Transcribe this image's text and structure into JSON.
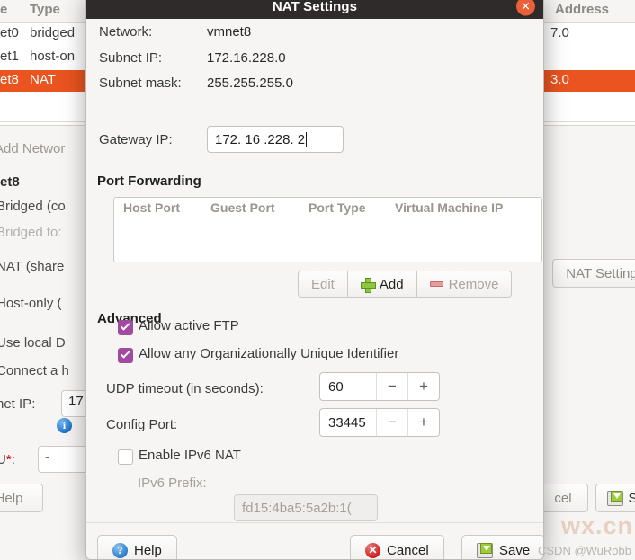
{
  "background": {
    "table": {
      "columns": [
        "e",
        "Type",
        "Address"
      ],
      "rows": [
        {
          "name": "et0",
          "type": "bridged",
          "address": "7.0",
          "selected": false
        },
        {
          "name": "et1",
          "type": "host-on",
          "address": "",
          "selected": false
        },
        {
          "name": "et8",
          "type": "NAT",
          "address": "3.0",
          "selected": true
        }
      ]
    },
    "add_network_button": "Add Networ",
    "vmnet_label": "et8",
    "radio_bridged": "Bridged (co",
    "bridged_to_label": "Bridged to:",
    "radio_nat": "NAT (share",
    "radio_hostonly": "Host-only (",
    "check_local_dhcp": "Use local D",
    "check_connect_host": "Connect a h",
    "subnet_ip_label": "net IP:",
    "subnet_ip_value": "17",
    "mtu_label": "U",
    "mtu_required_mark": "*",
    "mtu_suffix": ":",
    "mtu_value": "-",
    "help_button": "Help",
    "nat_settings_button": "NAT Setting",
    "cancel_button": "cel",
    "save_button": "S"
  },
  "dialog": {
    "title": "NAT Settings",
    "close_icon": "close-icon",
    "info": {
      "network_label": "Network:",
      "network_value": "vmnet8",
      "subnet_ip_label": "Subnet IP:",
      "subnet_ip_value": "172.16.228.0",
      "subnet_mask_label": "Subnet mask:",
      "subnet_mask_value": "255.255.255.0",
      "gateway_label": "Gateway IP:",
      "gateway_value": "172. 16 .228.  2"
    },
    "port_forwarding": {
      "section_title": "Port Forwarding",
      "columns": [
        "Host Port",
        "Guest Port",
        "Port Type",
        "Virtual Machine IP"
      ],
      "rows": [],
      "buttons": [
        {
          "label": "Edit",
          "icon": "",
          "enabled": false
        },
        {
          "label": "Add",
          "icon": "plus-icon",
          "enabled": true
        },
        {
          "label": "Remove",
          "icon": "minus-icon",
          "enabled": false
        }
      ]
    },
    "advanced": {
      "section_title": "Advanced",
      "allow_active_ftp": {
        "label": "Allow active FTP",
        "checked": true
      },
      "allow_oui": {
        "label": "Allow any Organizationally Unique Identifier",
        "checked": true
      },
      "udp_timeout": {
        "label": "UDP timeout (in seconds):",
        "value": "60",
        "minus": "−",
        "plus": "+"
      },
      "config_port": {
        "label": "Config Port:",
        "value": "33445",
        "minus": "−",
        "plus": "+"
      },
      "enable_ipv6_nat": {
        "label": "Enable IPv6 NAT",
        "checked": false
      },
      "ipv6_prefix": {
        "label": "IPv6 Prefix:",
        "value": "fd15:4ba5:5a2b:1("
      }
    },
    "footer": {
      "help_label": "Help",
      "cancel_label": "Cancel",
      "save_label": "Save"
    }
  },
  "watermark": {
    "big": "wx.cn",
    "small": "CSDN @WuRobb"
  },
  "colors": {
    "accent": "#e95420",
    "titlebar": "#2f2b2a",
    "checkbox": "#a349a4",
    "dialog_bg": "#f6f5f4"
  }
}
